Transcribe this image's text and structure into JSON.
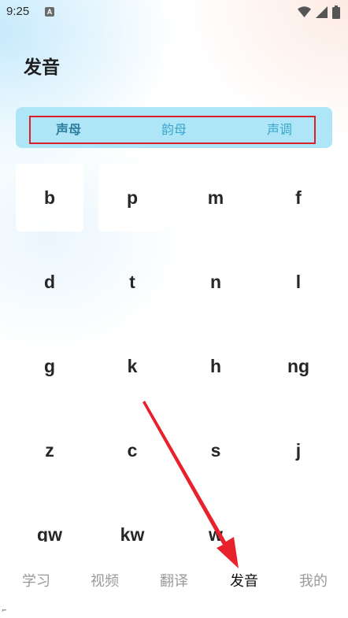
{
  "status_bar": {
    "time": "9:25",
    "notification_badge": "A",
    "icons": [
      "wifi-icon",
      "cellular-signal-icon",
      "battery-icon"
    ]
  },
  "page": {
    "title": "发音"
  },
  "segments": {
    "items": [
      {
        "label": "声母",
        "active": true
      },
      {
        "label": "韵母",
        "active": false
      },
      {
        "label": "声调",
        "active": false
      }
    ]
  },
  "consonants": {
    "rows": [
      [
        "b",
        "p",
        "m",
        "f"
      ],
      [
        "d",
        "t",
        "n",
        "l"
      ],
      [
        "g",
        "k",
        "h",
        "ng"
      ],
      [
        "z",
        "c",
        "s",
        "j"
      ],
      [
        "gw",
        "kw",
        "w"
      ]
    ]
  },
  "tabbar": {
    "items": [
      {
        "label": "学习",
        "active": false
      },
      {
        "label": "视频",
        "active": false
      },
      {
        "label": "翻译",
        "active": false
      },
      {
        "label": "发音",
        "active": true
      },
      {
        "label": "我的",
        "active": false
      }
    ]
  },
  "colors": {
    "segment_background": "#aee6f8",
    "segment_active_text": "#2d7f9e",
    "segment_text": "#3aa6c9",
    "annotation_red": "#d9202a",
    "tab_active": "#111111",
    "tab_inactive": "#9a9a9a"
  }
}
